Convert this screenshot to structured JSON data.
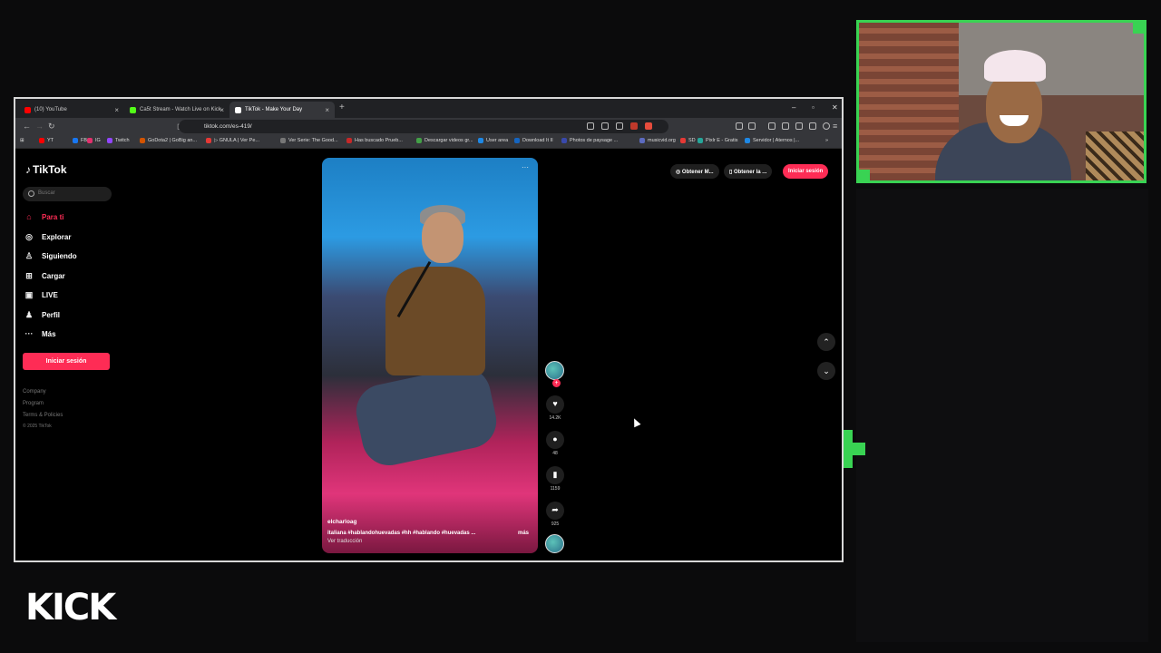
{
  "browser": {
    "tabs": [
      {
        "title": "(10) YouTube",
        "color": "#ff0000"
      },
      {
        "title": "Ca5t Stream - Watch Live on Kick",
        "color": "#53fc18"
      },
      {
        "title": "TikTok - Make Your Day",
        "color": "#ffffff"
      }
    ],
    "new_tab": "+",
    "url": "tiktok.com/es-419/",
    "bookmarks": [
      {
        "label": "YT",
        "color": "#ff0000"
      },
      {
        "label": "FB",
        "color": "#1877f2"
      },
      {
        "label": "IG",
        "color": "#e1306c"
      },
      {
        "label": "Twitch",
        "color": "#9146ff"
      },
      {
        "label": "GoDota2 | GoBig an...",
        "color": "#d35400"
      },
      {
        "label": "▷ GNULA | Ver Pe...",
        "color": "#e53935"
      },
      {
        "label": "Ver Serie: The Good...",
        "color": "#777777"
      },
      {
        "label": "Has buscado Prueb...",
        "color": "#c62828"
      },
      {
        "label": "Descargar videos gr...",
        "color": "#43a047"
      },
      {
        "label": "User area",
        "color": "#1e88e5"
      },
      {
        "label": "Download It II",
        "color": "#1565c0"
      },
      {
        "label": "Photos de paysage ...",
        "color": "#3949ab"
      },
      {
        "label": "musicvid.org",
        "color": "#5c6bc0"
      },
      {
        "label": "SD",
        "color": "#e53935"
      },
      {
        "label": "Pixlr E - Gratis",
        "color": "#26a69a"
      },
      {
        "label": "Servidor | Aternos |...",
        "color": "#1e88e5"
      }
    ]
  },
  "tiktok": {
    "logo": "TikTok",
    "search_placeholder": "Buscar",
    "nav": [
      {
        "label": "Para ti",
        "icon": "home-icon",
        "glyph": "⌂"
      },
      {
        "label": "Explorar",
        "icon": "compass-icon",
        "glyph": "◎"
      },
      {
        "label": "Siguiendo",
        "icon": "following-icon",
        "glyph": "♙"
      },
      {
        "label": "Cargar",
        "icon": "upload-icon",
        "glyph": "⊞"
      },
      {
        "label": "LIVE",
        "icon": "live-icon",
        "glyph": "▣"
      },
      {
        "label": "Perfil",
        "icon": "profile-icon",
        "glyph": "♟"
      },
      {
        "label": "Más",
        "icon": "more-icon",
        "glyph": "···"
      }
    ],
    "login_side": "Iniciar sesión",
    "footer": [
      "Company",
      "Program",
      "Terms & Policies",
      "© 2025 TikTok"
    ],
    "top": {
      "btn1": "Obtener M...",
      "btn2": "Obtener la ...",
      "login": "Iniciar sesión"
    },
    "video": {
      "username": "elcharloag",
      "caption": "italiana #hablandohuevadas  #hh  #hablando  #huevadas ...",
      "more": "más",
      "translate": "Ver traducción"
    },
    "actions": {
      "likes": "14.2K",
      "comments": "48",
      "saves": "1159",
      "shares": "925"
    }
  },
  "stream": {
    "platform_logo": "KICK",
    "accent": "#39d353"
  }
}
